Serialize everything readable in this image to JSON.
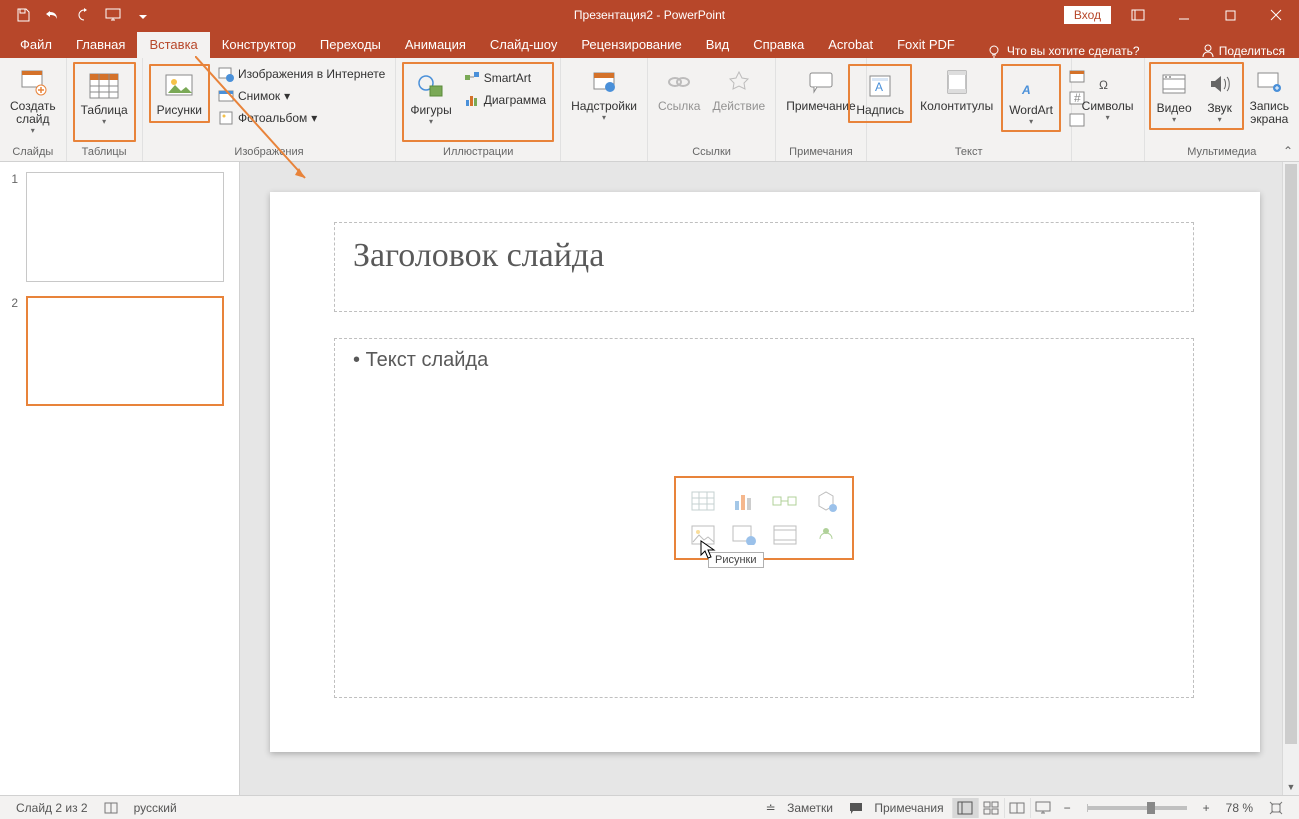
{
  "title": "Презентация2  -  PowerPoint",
  "signin": "Вход",
  "tabs": {
    "file": "Файл",
    "home": "Главная",
    "insert": "Вставка",
    "design": "Конструктор",
    "transitions": "Переходы",
    "animations": "Анимация",
    "slideshow": "Слайд-шоу",
    "review": "Рецензирование",
    "view": "Вид",
    "help": "Справка",
    "acrobat": "Acrobat",
    "foxit": "Foxit PDF"
  },
  "tell_me": "Что вы хотите сделать?",
  "share": "Поделиться",
  "ribbon": {
    "slides": {
      "new_slide": "Создать\nслайд",
      "group": "Слайды"
    },
    "tables": {
      "table": "Таблица",
      "group": "Таблицы"
    },
    "images": {
      "pictures": "Рисунки",
      "online": "Изображения в Интернете",
      "screenshot": "Снимок",
      "album": "Фотоальбом",
      "group": "Изображения"
    },
    "illustrations": {
      "shapes": "Фигуры",
      "smartart": "SmartArt",
      "chart": "Диаграмма",
      "group": "Иллюстрации"
    },
    "addins": {
      "addins": "Надстройки",
      "group": ""
    },
    "links": {
      "link": "Ссылка",
      "action": "Действие",
      "group": "Ссылки"
    },
    "comments": {
      "comment": "Примечание",
      "group": "Примечания"
    },
    "text": {
      "textbox": "Надпись",
      "headerfooter": "Колонтитулы",
      "wordart": "WordArt",
      "group": "Текст"
    },
    "symbols": {
      "symbols": "Символы",
      "group": ""
    },
    "media": {
      "video": "Видео",
      "audio": "Звук",
      "record": "Запись\nэкрана",
      "group": "Мультимедиа"
    }
  },
  "slide": {
    "title": "Заголовок слайда",
    "body": "Текст слайда",
    "tooltip": "Рисунки"
  },
  "thumbs": {
    "n1": "1",
    "n2": "2"
  },
  "status": {
    "slide": "Слайд 2 из 2",
    "lang": "русский",
    "notes": "Заметки",
    "comments": "Примечания",
    "zoom": "78 %"
  }
}
